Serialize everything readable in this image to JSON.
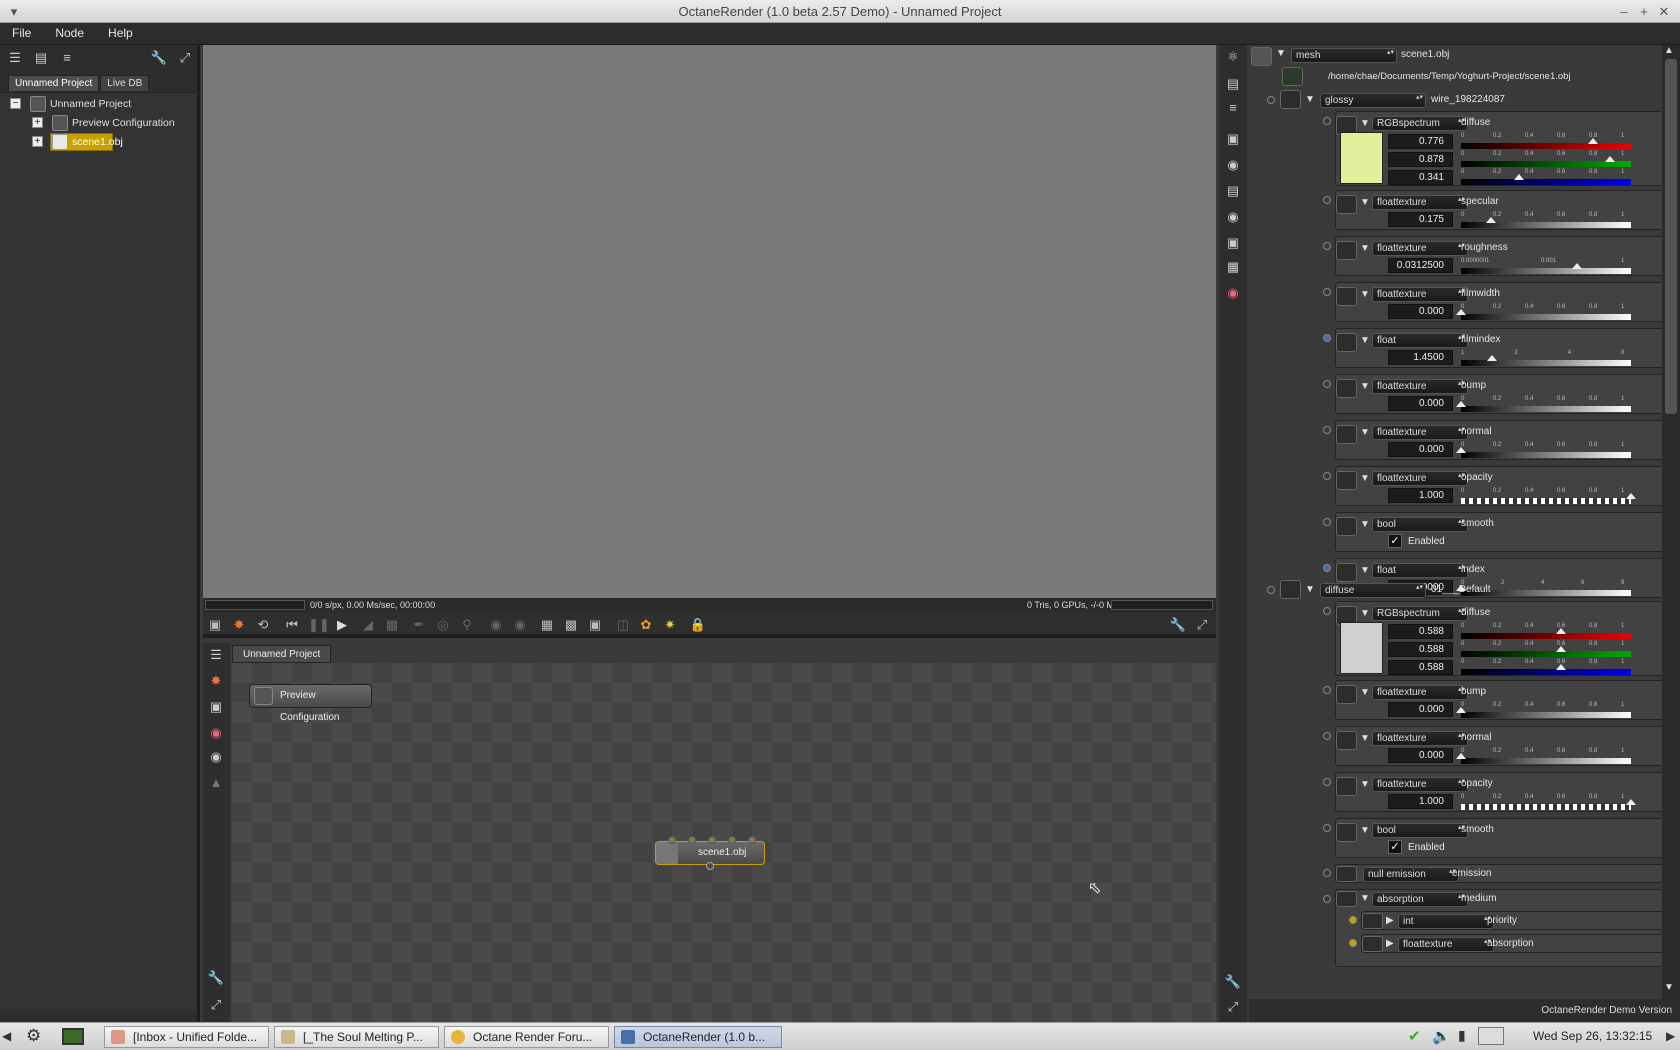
{
  "window": {
    "title": "OctaneRender (1.0 beta 2.57 Demo) - Unnamed Project"
  },
  "menu": [
    "File",
    "Node",
    "Help"
  ],
  "left_panel": {
    "tabs": [
      "Unnamed Project",
      "Live DB"
    ],
    "tree": [
      {
        "label": "Unnamed Project",
        "level": 0
      },
      {
        "label": "Preview Configuration",
        "level": 1
      },
      {
        "label": "scene1.obj",
        "level": 1,
        "selected": true
      }
    ]
  },
  "render_status": {
    "left": "0/0 s/px, 0.00 Ms/sec, 00:00:00",
    "right": "0 Tris, 0 GPUs, -/-0 MB"
  },
  "node_graph": {
    "tab": "Unnamed Project",
    "nodes": [
      "Preview Configuration",
      "scene1.obj"
    ]
  },
  "inspector": {
    "header": {
      "type": "mesh",
      "name": "scene1.obj",
      "path": "/home/chae/Documents/Temp/Yoghurt-Project/scene1.obj"
    },
    "material1": {
      "type": "glossy",
      "name": "wire_198224087",
      "diffuse": {
        "type": "RGBspectrum",
        "name": "diffuse",
        "r": "0.776",
        "g": "0.878",
        "b": "0.341",
        "color": "#e3ef9a"
      },
      "params": [
        {
          "type": "floattexture",
          "name": "specular",
          "value": "0.175",
          "ticks": [
            "0",
            "0.2",
            "0.4",
            "0.6",
            "0.8",
            "1"
          ],
          "pos": 0.175
        },
        {
          "type": "floattexture",
          "name": "roughness",
          "value": "0.0312500",
          "ticks": [
            "0.0000001",
            "0.001",
            "1"
          ],
          "pos": 0.68
        },
        {
          "type": "floattexture",
          "name": "filmwidth",
          "value": "0.000",
          "ticks": [
            "0",
            "0.2",
            "0.4",
            "0.6",
            "0.8",
            "1"
          ],
          "pos": 0.0
        },
        {
          "type": "float",
          "name": "filmindex",
          "value": "1.4500",
          "ticks": [
            "1",
            "2",
            "4",
            "8"
          ],
          "pos": 0.18
        },
        {
          "type": "floattexture",
          "name": "bump",
          "value": "0.000",
          "ticks": [
            "0",
            "0.2",
            "0.4",
            "0.6",
            "0.8",
            "1"
          ],
          "pos": 0.0
        },
        {
          "type": "floattexture",
          "name": "normal",
          "value": "0.000",
          "ticks": [
            "0",
            "0.2",
            "0.4",
            "0.6",
            "0.8",
            "1"
          ],
          "pos": 0.0
        },
        {
          "type": "floattexture",
          "name": "opacity",
          "value": "1.000",
          "ticks": [
            "0",
            "0.2",
            "0.4",
            "0.6",
            "0.8",
            "1"
          ],
          "pos": 1.0
        },
        {
          "type": "bool",
          "name": "smooth",
          "check": "Enabled"
        },
        {
          "type": "float",
          "name": "index",
          "value": "0.0000",
          "ticks": [
            "0",
            "2",
            "4",
            "6",
            "8"
          ],
          "pos": 0.0
        }
      ]
    },
    "material2": {
      "type": "diffuse",
      "name": "01___Default",
      "diffuse": {
        "type": "RGBspectrum",
        "name": "diffuse",
        "r": "0.588",
        "g": "0.588",
        "b": "0.588",
        "color": "#d0d0d0"
      },
      "params": [
        {
          "type": "floattexture",
          "name": "bump",
          "value": "0.000",
          "ticks": [
            "0",
            "0.2",
            "0.4",
            "0.6",
            "0.8",
            "1"
          ],
          "pos": 0.0
        },
        {
          "type": "floattexture",
          "name": "normal",
          "value": "0.000",
          "ticks": [
            "0",
            "0.2",
            "0.4",
            "0.6",
            "0.8",
            "1"
          ],
          "pos": 0.0
        },
        {
          "type": "floattexture",
          "name": "opacity",
          "value": "1.000",
          "ticks": [
            "0",
            "0.2",
            "0.4",
            "0.6",
            "0.8",
            "1"
          ],
          "pos": 1.0
        },
        {
          "type": "bool",
          "name": "smooth",
          "check": "Enabled"
        }
      ],
      "emission": {
        "type": "null emission",
        "name": "emission"
      },
      "medium": {
        "type": "absorption",
        "name": "medium"
      },
      "priority": {
        "type": "int",
        "name": "priority"
      },
      "absorption": {
        "type": "floattexture",
        "name": "absorption"
      }
    },
    "footer": "OctaneRender Demo Version"
  },
  "taskbar": {
    "tasks": [
      "[Inbox - Unified Folde...",
      "[_The Soul Melting P...",
      "Octane Render Foru...",
      "OctaneRender (1.0 b..."
    ],
    "clock": "Wed Sep 26, 13:32:15"
  }
}
